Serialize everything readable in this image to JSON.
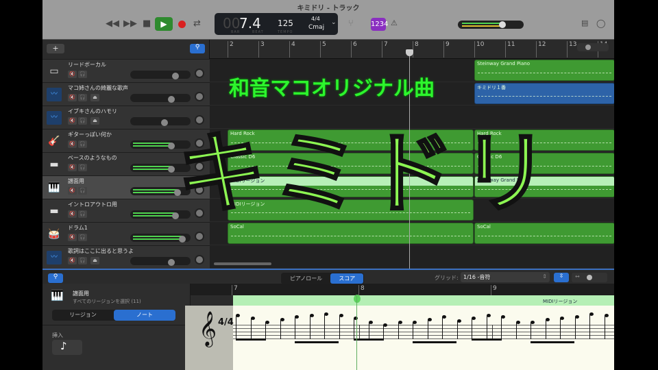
{
  "window_title": "キミドリ - トラック",
  "transport": {
    "rewind": "◀◀",
    "forward": "▶▶",
    "stop": "■",
    "play": "▶",
    "cycle": "⇄"
  },
  "lcd": {
    "bar_dim": "00",
    "position": "7.4",
    "bar_label": "BAR",
    "beat_label": "BEAT",
    "tempo": "125",
    "tempo_label": "TEMPO",
    "signature": "4/4",
    "key": "Cmaj"
  },
  "count_in": "1234",
  "master_volume": 0.68,
  "header": {
    "add": "+"
  },
  "tracks": [
    {
      "name": "リードボーカル",
      "icon": "keyboard-icon",
      "volume": 0.78,
      "meter": false,
      "monitor": false
    },
    {
      "name": "マコ姉さんの綺麗な歌声",
      "icon": "audio-wave-icon",
      "volume": 0.72,
      "meter": false,
      "monitor": true
    },
    {
      "name": "イブキさんのハモリ",
      "icon": "audio-wave-icon",
      "volume": 0.6,
      "meter": false,
      "monitor": true
    },
    {
      "name": "ギターっぽい何か",
      "icon": "guitar-icon",
      "volume": 0.72,
      "meter": true,
      "monitor": false
    },
    {
      "name": "ベースのようなもの",
      "icon": "electric-piano-icon",
      "volume": 0.72,
      "meter": true,
      "monitor": false
    },
    {
      "name": "譜面用",
      "icon": "grand-piano-icon",
      "volume": 0.82,
      "meter": true,
      "monitor": false,
      "selected": true
    },
    {
      "name": "イントロアウトロ用",
      "icon": "electric-piano-icon",
      "volume": 0.78,
      "meter": true,
      "monitor": false
    },
    {
      "name": "ドラム1",
      "icon": "drums-icon",
      "volume": 0.9,
      "meter": true,
      "monitor": false
    },
    {
      "name": "歌詞はここに出ると思うよ",
      "icon": "audio-wave-icon",
      "volume": 0.72,
      "meter": false,
      "monitor": true
    }
  ],
  "ruler": [
    "2",
    "3",
    "4",
    "5",
    "6",
    "7",
    "8",
    "9",
    "10",
    "11",
    "12",
    "13",
    "14"
  ],
  "regions": [
    {
      "track": 0,
      "label": "Steinway Grand Piano",
      "start": 10,
      "end": 15,
      "kind": "midi"
    },
    {
      "track": 1,
      "label": "キミドリ１番",
      "start": 10,
      "end": 15,
      "kind": "audio"
    },
    {
      "track": 3,
      "label": "Hard Rock",
      "start": 2,
      "end": 10,
      "kind": "midi"
    },
    {
      "track": 3,
      "label": "Hard Rock",
      "start": 10,
      "end": 15,
      "kind": "midi"
    },
    {
      "track": 4,
      "label": "Classic D6",
      "start": 2,
      "end": 10,
      "kind": "midi"
    },
    {
      "track": 4,
      "label": "Classic D6",
      "start": 10,
      "end": 15,
      "kind": "midi"
    },
    {
      "track": 5,
      "label": "MIDIリージョン",
      "start": 2,
      "end": 10,
      "kind": "selected"
    },
    {
      "track": 5,
      "label": "Steinway Grand Piano",
      "start": 10,
      "end": 15,
      "kind": "selected"
    },
    {
      "track": 6,
      "label": "MIDIリージョン",
      "start": 2,
      "end": 10,
      "kind": "midi"
    },
    {
      "track": 7,
      "label": "SoCal",
      "start": 2,
      "end": 10,
      "kind": "midi"
    },
    {
      "track": 7,
      "label": "SoCal",
      "start": 10,
      "end": 15,
      "kind": "midi"
    }
  ],
  "playhead_position": "7.4",
  "overlay": {
    "subtitle": "和音マコオリジナル曲",
    "title": "キミドリ"
  },
  "editor": {
    "tabs": [
      "ピアノロール",
      "スコア"
    ],
    "active_tab": "スコア",
    "grid_label": "グリッド:",
    "grid_value": "1/16 -音符",
    "track_name": "譜面用",
    "selection_info": "すべてのリージョンを選択 (11)",
    "segments": [
      "リージョン",
      "ノート"
    ],
    "active_segment": "ノート",
    "insert_label": "挿入",
    "insert_value": "♪",
    "ruler": [
      "7",
      "8",
      "9"
    ],
    "region_label": "MIDIリージョン",
    "time_signature": "4/4"
  }
}
